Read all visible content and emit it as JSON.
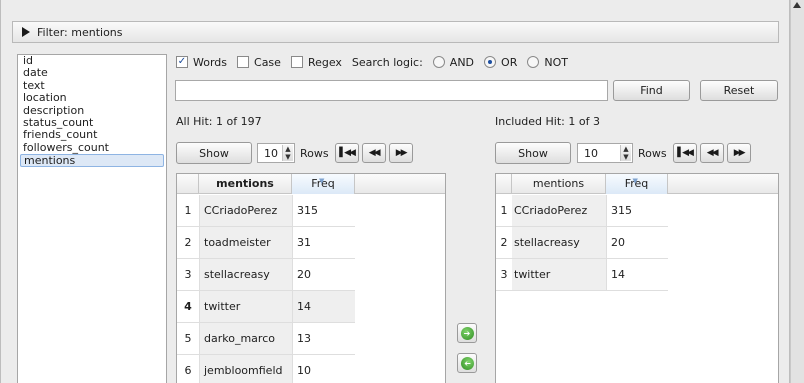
{
  "filter": {
    "title": "Filter: mentions"
  },
  "fields": [
    "id",
    "date",
    "text",
    "location",
    "description",
    "status_count",
    "friends_count",
    "followers_count",
    "mentions"
  ],
  "options": {
    "words_label": "Words",
    "words_checked": true,
    "case_label": "Case",
    "regex_label": "Regex",
    "search_logic_label": "Search logic:",
    "and_label": "AND",
    "or_label": "OR",
    "not_label": "NOT",
    "selected_logic": "OR"
  },
  "search": {
    "value": "",
    "find_label": "Find",
    "reset_label": "Reset"
  },
  "all": {
    "hit_label": "All Hit:  1  of  197",
    "show_label": "Show",
    "rows_value": "10",
    "rows_label": "Rows",
    "columns": [
      "mentions",
      "Freq"
    ],
    "rows": [
      {
        "idx": "1",
        "mention": "CCriadoPerez",
        "freq": "315"
      },
      {
        "idx": "2",
        "mention": "toadmeister",
        "freq": "31"
      },
      {
        "idx": "3",
        "mention": "stellacreasy",
        "freq": "20"
      },
      {
        "idx": "4",
        "mention": "twitter",
        "freq": "14"
      },
      {
        "idx": "5",
        "mention": "darko_marco",
        "freq": "13"
      },
      {
        "idx": "6",
        "mention": "jembloomfield",
        "freq": "10"
      }
    ]
  },
  "included": {
    "hit_label": "Included Hit:  1  of  3",
    "show_label": "Show",
    "rows_value": "10",
    "rows_label": "Rows",
    "columns": [
      "mentions",
      "Freq"
    ],
    "rows": [
      {
        "idx": "1",
        "mention": "CCriadoPerez",
        "freq": "315"
      },
      {
        "idx": "2",
        "mention": "stellacreasy",
        "freq": "20"
      },
      {
        "idx": "3",
        "mention": "twitter",
        "freq": "14"
      }
    ]
  },
  "icons": {
    "expand": "triangle-right-icon",
    "first": "first-page-icon",
    "prev": "previous-page-icon",
    "next": "next-page-icon",
    "move_right": "move-right-icon",
    "move_left": "move-left-icon"
  },
  "colors": {
    "selection": "#dde8f6",
    "accent": "#1d4fa0",
    "green": "#2f8d22"
  }
}
